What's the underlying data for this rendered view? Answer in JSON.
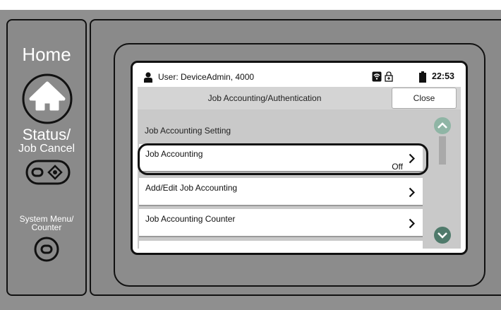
{
  "panel": {
    "home_label": "Home",
    "status_label_line1": "Status/",
    "status_label_line2": "Job Cancel",
    "system_menu_line1": "System Menu/",
    "system_menu_line2": "Counter"
  },
  "status_bar": {
    "user_text": "User: DeviceAdmin, 4000",
    "time": "22:53",
    "icons": [
      "user-icon",
      "wifi-icon",
      "lock-icon",
      "battery-icon"
    ]
  },
  "title_bar": {
    "title": "Job Accounting/Authentication",
    "close_label": "Close"
  },
  "section": {
    "header": "Job Accounting Setting"
  },
  "list": [
    {
      "label": "Job Accounting",
      "value": "Off"
    },
    {
      "label": "Add/Edit Job Accounting",
      "value": ""
    },
    {
      "label": "Job Accounting Counter",
      "value": ""
    }
  ],
  "colors": {
    "panel_gray": "#8a8a8a",
    "screen_gray": "#c9c9c9",
    "scroll_green": "#4f7a6b"
  }
}
